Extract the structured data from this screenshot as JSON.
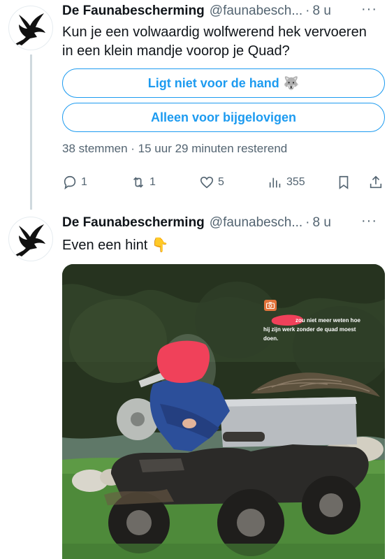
{
  "tweets": [
    {
      "author_name": "De Faunabescherming",
      "handle": "@faunabesch...",
      "separator": "·",
      "time": "8 u",
      "more": "···",
      "text": "Kun je een volwaardig wolfwerend hek vervoeren in een klein mandje voorop je Quad?",
      "poll": {
        "options": [
          {
            "label": "Ligt niet voor de hand",
            "emoji": "🐺"
          },
          {
            "label": "Alleen voor bijgelovigen",
            "emoji": ""
          }
        ],
        "meta": "38 stemmen · 15 uur 29 minuten resterend"
      },
      "actions": {
        "replies": "1",
        "retweets": "1",
        "likes": "5",
        "views": "355"
      }
    },
    {
      "author_name": "De Faunabescherming",
      "handle": "@faunabesch...",
      "separator": "·",
      "time": "8 u",
      "more": "···",
      "text": "Even een hint 👇",
      "media": {
        "overlay_text": [
          "zou niet meer weten hoe",
          "hij zijn werk zonder de quad moest",
          "doen."
        ],
        "badge_icon": "camera-icon",
        "colors": {
          "sky": "#5f7868",
          "trees": "#26331f",
          "grass": "#4e8a3a",
          "jacket": "#2c4f9a",
          "redaction": "#f0415a",
          "quad": "#2b2a28",
          "crate": "#b8bcc0"
        }
      }
    }
  ],
  "colors": {
    "accent": "#1d9bf0",
    "secondary_text": "#536471",
    "thread_line": "#cfd9de"
  }
}
